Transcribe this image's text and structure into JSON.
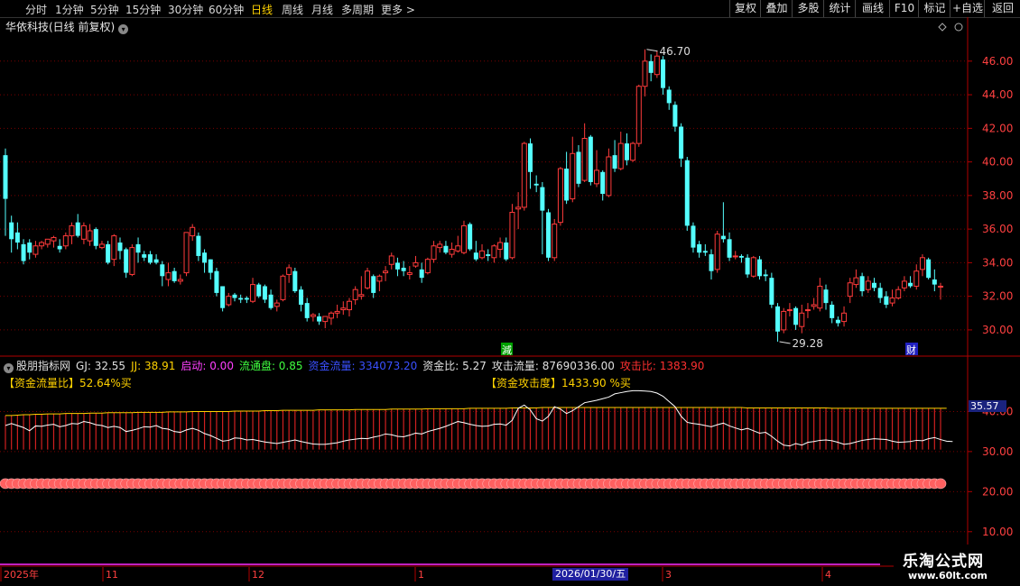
{
  "toolbar": {
    "periods": [
      "分时",
      "1分钟",
      "5分钟",
      "15分钟",
      "30分钟",
      "60分钟",
      "日线",
      "周线",
      "月线",
      "多周期",
      "更多 >"
    ],
    "active_period": "日线",
    "right_buttons": [
      "复权",
      "叠加",
      "多股",
      "统计",
      "画线",
      "F10",
      "标记",
      "+自选",
      "返回"
    ]
  },
  "chart_title": "华依科技(日线 前复权)",
  "annotations": {
    "high": "46.70",
    "low": "29.28",
    "marker_jian": "減",
    "marker_cai": "财"
  },
  "indicator": {
    "name": "股朋指标网",
    "items": [
      {
        "label": "GJ: 32.55",
        "color": "#e0e0e0"
      },
      {
        "label": "JJ: 38.91",
        "color": "#ffd200"
      },
      {
        "label": "启动: 0.00",
        "color": "#ff40ff"
      },
      {
        "label": "流通盘: 0.85",
        "color": "#40ff40"
      },
      {
        "label": "资金流量: 334073.20",
        "color": "#3a50ff"
      },
      {
        "label": "资金比: 5.27",
        "color": "#e0e0e0"
      },
      {
        "label": "攻击流量: 87690336.00",
        "color": "#e0e0e0"
      },
      {
        "label": "攻击比: 1383.90",
        "color": "#ff3030"
      }
    ],
    "label_left": "【资金流量比】52.64%买",
    "label_mid": "【资金攻击度】1433.90 %买"
  },
  "cursor_value": "35.57",
  "cursor_date": "2026/01/30/五",
  "x_labels": [
    "2025年",
    "11",
    "12",
    "1",
    "3",
    "4"
  ],
  "brand": {
    "name": "乐淘公式网",
    "url": "www.60lt.com"
  },
  "colors": {
    "up": "#ff3b3b",
    "down": "#54ffff",
    "grid": "#7a0000",
    "axis": "#b00000"
  },
  "chart_data": {
    "type": "candlestick",
    "price_axis": {
      "ticks": [
        30.0,
        32.0,
        34.0,
        36.0,
        38.0,
        40.0,
        42.0,
        44.0,
        46.0
      ],
      "range": [
        28.6,
        47.6
      ]
    },
    "indicator_axis": {
      "ticks": [
        10.0,
        20.0,
        30.0,
        40.0
      ],
      "range": [
        5,
        50
      ]
    },
    "candles": [
      [
        40.4,
        37.8,
        40.8,
        35.6
      ],
      [
        36.4,
        35.4,
        36.8,
        34.6
      ],
      [
        35.8,
        35.2,
        36.4,
        34.8
      ],
      [
        35.1,
        34.1,
        35.4,
        33.9
      ],
      [
        35.2,
        34.6,
        35.4,
        34.2
      ],
      [
        34.5,
        35.0,
        35.3,
        34.3
      ],
      [
        35.0,
        35.2,
        35.3,
        34.8
      ],
      [
        35.1,
        35.4,
        35.4,
        34.9
      ],
      [
        35.3,
        35.5,
        35.6,
        34.9
      ],
      [
        35.0,
        34.8,
        35.4,
        34.6
      ],
      [
        35.0,
        35.6,
        35.8,
        34.8
      ],
      [
        35.6,
        36.2,
        36.4,
        35.1
      ],
      [
        36.4,
        35.6,
        36.9,
        35.5
      ],
      [
        35.4,
        36.2,
        36.4,
        35.1
      ],
      [
        35.3,
        35.9,
        36.3,
        35.0
      ],
      [
        36.0,
        35.0,
        36.1,
        34.8
      ],
      [
        34.9,
        35.1,
        35.3,
        34.8
      ],
      [
        35.1,
        34.0,
        35.3,
        33.9
      ],
      [
        34.2,
        35.6,
        35.7,
        33.8
      ],
      [
        35.2,
        34.7,
        35.5,
        34.2
      ],
      [
        34.8,
        33.4,
        34.9,
        33.1
      ],
      [
        33.3,
        34.9,
        35.1,
        33.2
      ],
      [
        35.1,
        34.6,
        35.5,
        34.0
      ],
      [
        34.5,
        34.3,
        34.7,
        34.1
      ],
      [
        34.5,
        34.0,
        34.7,
        33.9
      ],
      [
        34.2,
        34.0,
        34.5,
        33.9
      ],
      [
        33.9,
        33.2,
        34.1,
        32.6
      ],
      [
        33.0,
        33.4,
        34.0,
        32.6
      ],
      [
        33.5,
        32.9,
        33.7,
        32.8
      ],
      [
        32.9,
        33.0,
        33.3,
        32.7
      ],
      [
        33.4,
        35.8,
        35.8,
        33.2
      ],
      [
        35.6,
        36.1,
        36.3,
        35.3
      ],
      [
        35.6,
        34.4,
        35.8,
        34.1
      ],
      [
        34.6,
        34.0,
        34.8,
        33.4
      ],
      [
        34.2,
        33.4,
        34.2,
        33.0
      ],
      [
        33.5,
        32.2,
        33.7,
        32.0
      ],
      [
        32.6,
        31.3,
        32.6,
        31.1
      ],
      [
        31.5,
        32.0,
        32.2,
        31.4
      ],
      [
        32.1,
        31.9,
        32.2,
        31.7
      ],
      [
        31.9,
        31.8,
        32.1,
        31.6
      ],
      [
        31.9,
        31.8,
        32.0,
        31.6
      ],
      [
        31.7,
        32.7,
        33.1,
        31.6
      ],
      [
        32.7,
        32.0,
        32.8,
        31.9
      ],
      [
        32.6,
        31.8,
        32.7,
        31.6
      ],
      [
        32.1,
        31.3,
        32.4,
        31.2
      ],
      [
        31.4,
        31.6,
        31.8,
        31.1
      ],
      [
        31.8,
        33.2,
        33.3,
        31.7
      ],
      [
        33.3,
        33.7,
        33.9,
        32.8
      ],
      [
        33.5,
        32.3,
        33.7,
        32.2
      ],
      [
        32.4,
        31.5,
        32.6,
        31.1
      ],
      [
        31.6,
        30.7,
        31.9,
        30.5
      ],
      [
        30.8,
        30.9,
        31.0,
        30.5
      ],
      [
        30.8,
        30.5,
        31.0,
        30.3
      ],
      [
        30.5,
        30.8,
        30.8,
        30.1
      ],
      [
        30.7,
        31.0,
        31.1,
        30.3
      ],
      [
        31.0,
        31.1,
        31.5,
        30.7
      ],
      [
        31.2,
        31.3,
        31.7,
        30.9
      ],
      [
        31.2,
        31.7,
        31.9,
        30.8
      ],
      [
        31.8,
        32.4,
        32.6,
        31.5
      ],
      [
        32.0,
        32.1,
        33.2,
        31.8
      ],
      [
        32.5,
        33.5,
        33.7,
        32.4
      ],
      [
        33.2,
        32.2,
        33.3,
        31.9
      ],
      [
        32.9,
        33.2,
        33.3,
        32.3
      ],
      [
        33.4,
        33.5,
        33.8,
        32.9
      ],
      [
        33.9,
        34.4,
        34.6,
        33.6
      ],
      [
        34.0,
        33.6,
        34.3,
        33.2
      ],
      [
        33.7,
        33.5,
        34.1,
        33.2
      ],
      [
        33.3,
        33.4,
        33.8,
        33.0
      ],
      [
        33.8,
        34.0,
        34.4,
        33.7
      ],
      [
        33.6,
        33.1,
        34.0,
        32.8
      ],
      [
        33.4,
        34.2,
        34.3,
        33.3
      ],
      [
        34.2,
        35.0,
        35.3,
        34.0
      ],
      [
        34.9,
        35.1,
        35.3,
        34.6
      ],
      [
        35.0,
        34.6,
        35.3,
        34.5
      ],
      [
        34.5,
        34.8,
        35.2,
        34.3
      ],
      [
        34.7,
        35.0,
        35.6,
        34.6
      ],
      [
        34.6,
        36.2,
        36.5,
        34.5
      ],
      [
        36.3,
        34.8,
        36.4,
        34.7
      ],
      [
        34.6,
        34.2,
        35.3,
        34.1
      ],
      [
        34.3,
        34.7,
        35.1,
        34.2
      ],
      [
        34.5,
        34.4,
        34.8,
        34.1
      ],
      [
        34.3,
        35.0,
        35.1,
        34.0
      ],
      [
        34.8,
        35.2,
        35.5,
        34.3
      ],
      [
        35.2,
        34.2,
        35.5,
        34.1
      ],
      [
        34.3,
        37.0,
        37.5,
        34.2
      ],
      [
        37.2,
        37.3,
        38.2,
        36.0
      ],
      [
        37.3,
        41.1,
        41.2,
        37.1
      ],
      [
        41.1,
        39.4,
        41.4,
        38.4
      ],
      [
        38.7,
        38.6,
        39.2,
        38.2
      ],
      [
        38.5,
        37.1,
        38.8,
        34.5
      ],
      [
        37.0,
        34.3,
        37.2,
        34.1
      ],
      [
        34.3,
        36.3,
        36.6,
        34.1
      ],
      [
        36.4,
        39.6,
        39.7,
        36.2
      ],
      [
        39.6,
        37.7,
        40.6,
        37.5
      ],
      [
        37.8,
        40.5,
        41.5,
        37.6
      ],
      [
        40.6,
        38.7,
        41.0,
        38.5
      ],
      [
        38.9,
        41.4,
        42.3,
        38.8
      ],
      [
        41.5,
        38.8,
        41.6,
        38.6
      ],
      [
        38.7,
        39.5,
        40.7,
        38.5
      ],
      [
        39.4,
        38.1,
        39.5,
        37.7
      ],
      [
        38.0,
        40.3,
        40.8,
        37.9
      ],
      [
        40.4,
        39.6,
        41.3,
        39.4
      ],
      [
        39.6,
        41.1,
        41.8,
        39.5
      ],
      [
        41.1,
        40.1,
        41.7,
        39.8
      ],
      [
        40.1,
        41.1,
        41.2,
        40.0
      ],
      [
        41.1,
        44.5,
        44.6,
        40.9
      ],
      [
        44.5,
        46.0,
        46.7,
        43.9
      ],
      [
        46.0,
        45.3,
        46.4,
        44.8
      ],
      [
        45.2,
        46.3,
        46.6,
        45.0
      ],
      [
        46.1,
        44.4,
        46.3,
        44.0
      ],
      [
        44.3,
        43.5,
        44.5,
        43.1
      ],
      [
        43.4,
        42.1,
        43.6,
        41.8
      ],
      [
        42.1,
        40.2,
        42.3,
        39.7
      ],
      [
        40.1,
        36.2,
        40.3,
        35.9
      ],
      [
        36.2,
        34.9,
        36.4,
        34.6
      ],
      [
        35.1,
        34.6,
        35.3,
        34.3
      ],
      [
        34.7,
        34.6,
        35.1,
        34.4
      ],
      [
        34.5,
        33.5,
        34.8,
        33.0
      ],
      [
        33.6,
        35.7,
        35.9,
        33.4
      ],
      [
        35.6,
        35.4,
        37.6,
        35.2
      ],
      [
        35.4,
        34.3,
        35.8,
        34.1
      ],
      [
        34.4,
        34.4,
        34.7,
        34.2
      ],
      [
        34.4,
        34.3,
        34.5,
        34.0
      ],
      [
        34.3,
        33.3,
        34.5,
        33.1
      ],
      [
        33.2,
        34.3,
        34.4,
        33.1
      ],
      [
        34.2,
        33.2,
        34.4,
        33.0
      ],
      [
        33.3,
        33.2,
        33.6,
        32.9
      ],
      [
        33.1,
        31.5,
        33.4,
        31.3
      ],
      [
        31.4,
        29.9,
        31.6,
        29.3
      ],
      [
        30.0,
        31.1,
        31.3,
        29.8
      ],
      [
        31.2,
        31.2,
        31.6,
        30.8
      ],
      [
        31.3,
        30.3,
        31.4,
        30.0
      ],
      [
        30.2,
        31.0,
        31.5,
        29.8
      ],
      [
        31.2,
        31.2,
        31.6,
        30.7
      ],
      [
        31.4,
        31.5,
        31.9,
        31.2
      ],
      [
        31.3,
        32.6,
        33.1,
        31.1
      ],
      [
        32.4,
        31.6,
        32.7,
        31.2
      ],
      [
        31.5,
        30.7,
        31.7,
        30.4
      ],
      [
        30.6,
        30.4,
        30.8,
        30.2
      ],
      [
        30.5,
        31.0,
        31.4,
        30.2
      ],
      [
        32.0,
        32.8,
        33.1,
        31.6
      ],
      [
        32.7,
        33.1,
        33.6,
        32.5
      ],
      [
        33.2,
        32.3,
        33.4,
        32.0
      ],
      [
        32.4,
        32.9,
        33.2,
        32.2
      ],
      [
        32.8,
        32.5,
        33.1,
        32.3
      ],
      [
        32.5,
        31.9,
        32.8,
        31.6
      ],
      [
        32.0,
        31.5,
        32.3,
        31.3
      ],
      [
        31.6,
        31.9,
        32.4,
        31.4
      ],
      [
        31.9,
        32.4,
        32.6,
        31.8
      ],
      [
        32.5,
        32.9,
        33.2,
        32.3
      ],
      [
        32.8,
        32.6,
        33.2,
        32.5
      ],
      [
        32.6,
        33.5,
        33.9,
        32.4
      ],
      [
        33.6,
        34.3,
        34.5,
        33.2
      ],
      [
        34.2,
        33.1,
        34.3,
        33.0
      ],
      [
        33.0,
        32.7,
        33.6,
        32.3
      ],
      [
        32.6,
        32.6,
        32.8,
        31.8
      ]
    ],
    "jj_line": [
      39.0,
      39.0,
      39.1,
      39.2,
      39.2,
      39.3,
      39.3,
      39.4,
      39.4,
      39.4,
      39.5,
      39.5,
      39.5,
      39.5,
      39.6,
      39.6,
      39.6,
      39.7,
      39.7,
      39.7,
      39.7,
      39.7,
      39.8,
      39.8,
      39.8,
      39.8,
      39.8,
      39.9,
      39.9,
      39.9,
      39.9,
      40.0,
      40.0,
      40.0,
      40.0,
      40.0,
      40.0,
      40.0,
      40.1,
      40.1,
      40.1,
      40.1,
      40.1,
      40.2,
      40.2,
      40.2,
      40.3,
      40.3,
      40.3,
      40.3,
      40.3,
      40.3,
      40.4,
      40.4,
      40.4,
      40.4,
      40.4,
      40.4,
      40.5,
      40.5,
      40.5,
      40.5,
      40.5,
      40.5,
      40.6,
      40.6,
      40.6,
      40.6,
      40.6,
      40.6,
      40.7,
      40.7,
      40.7,
      40.7,
      40.7,
      40.7,
      40.7,
      40.8,
      40.8,
      40.8,
      40.8,
      40.8,
      40.8,
      40.8,
      40.9,
      40.9,
      40.9,
      40.9,
      40.9,
      41.0,
      41.0,
      41.0,
      41.0,
      41.0,
      41.0,
      41.0,
      41.0,
      41.0,
      41.0,
      41.0,
      41.0,
      41.0,
      41.0,
      41.0,
      41.0,
      41.0,
      41.0,
      41.0,
      41.0,
      41.0,
      41.0,
      41.0,
      41.0,
      41.0,
      41.0,
      41.0,
      41.0,
      41.0,
      41.0,
      41.0,
      41.0,
      41.0,
      41.0,
      40.9,
      40.9,
      40.9,
      40.9,
      40.9,
      40.9,
      40.9,
      40.9,
      40.9,
      40.9,
      40.9,
      40.9,
      40.9,
      40.9,
      40.8,
      40.8,
      40.8,
      40.8,
      40.8,
      40.8,
      40.8,
      40.8,
      40.8,
      40.8,
      40.8,
      40.8,
      40.8,
      40.8,
      40.8,
      40.8,
      40.8,
      40.8,
      40.8,
      40.8
    ],
    "gj_line": [
      36.5,
      37.0,
      36.5,
      36.0,
      35.2,
      36.4,
      36.3,
      36.6,
      36.8,
      36.2,
      36.5,
      37.0,
      36.9,
      37.5,
      37.2,
      36.7,
      36.5,
      36.0,
      36.3,
      36.0,
      35.0,
      35.3,
      35.7,
      36.2,
      36.1,
      36.5,
      35.8,
      35.6,
      35.0,
      34.8,
      35.4,
      35.8,
      35.3,
      34.5,
      34.0,
      33.3,
      32.6,
      32.8,
      33.4,
      33.3,
      32.9,
      33.0,
      32.7,
      32.4,
      32.2,
      32.0,
      32.3,
      32.6,
      32.9,
      32.5,
      32.2,
      31.9,
      31.8,
      31.8,
      32.0,
      32.2,
      32.6,
      32.9,
      33.1,
      33.3,
      33.2,
      33.6,
      33.9,
      34.4,
      34.2,
      33.8,
      33.7,
      34.1,
      34.6,
      34.4,
      35.0,
      35.4,
      35.8,
      36.3,
      36.9,
      37.5,
      37.2,
      36.8,
      36.5,
      36.3,
      36.4,
      36.8,
      36.9,
      36.6,
      37.8,
      40.8,
      41.6,
      40.4,
      38.2,
      37.6,
      38.8,
      41.2,
      40.6,
      39.5,
      40.2,
      41.2,
      42.2,
      42.5,
      42.8,
      43.2,
      43.6,
      44.4,
      44.7,
      45.0,
      45.2,
      45.2,
      45.1,
      45.0,
      44.6,
      43.8,
      42.5,
      41.2,
      38.8,
      37.3,
      37.0,
      36.8,
      36.5,
      36.2,
      36.7,
      37.1,
      36.4,
      35.9,
      35.4,
      35.8,
      35.2,
      34.6,
      34.8,
      33.8,
      32.6,
      31.6,
      31.4,
      32.0,
      31.6,
      32.3,
      32.5,
      32.8,
      32.9,
      32.7,
      32.3,
      31.8,
      32.0,
      32.4,
      32.8,
      33.0,
      33.2,
      33.1,
      33.0,
      32.6,
      32.3,
      32.4,
      32.5,
      32.8,
      32.7,
      33.2,
      33.5,
      33.0,
      32.6,
      32.5
    ],
    "bar_value": 30.5,
    "ball_row_value": 22.0
  }
}
